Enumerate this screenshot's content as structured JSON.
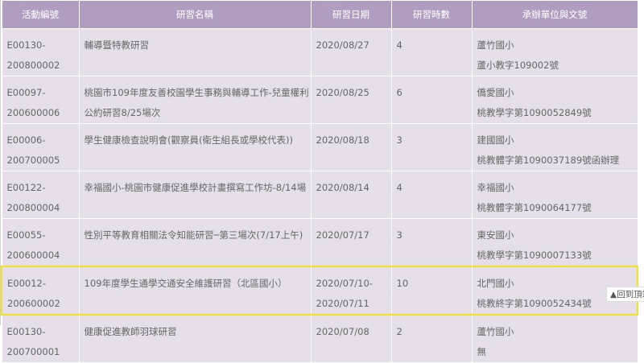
{
  "headers": [
    "活動編號",
    "研習名稱",
    "研習日期",
    "研習時數",
    "承辦單位與文號"
  ],
  "rows": [
    {
      "id": [
        "E00130-",
        "200800002"
      ],
      "name": [
        "輔導暨特教研習"
      ],
      "date": [
        "2020/08/27"
      ],
      "hours": "4",
      "unit": [
        "蘆竹國小",
        "蘆小教字109002號"
      ]
    },
    {
      "id": [
        "E00097-",
        "200600006"
      ],
      "name": [
        "桃園市109年度友善校園學生事務與輔導工作-兒童權利",
        "公約研習8/25場次"
      ],
      "date": [
        "2020/08/25"
      ],
      "hours": "6",
      "unit": [
        "僑愛國小",
        "桃教學字第1090052849號"
      ]
    },
    {
      "id": [
        "E00006-",
        "200700005"
      ],
      "name": [
        "學生健康檢查說明會(觀察員(衛生組長或學校代表))"
      ],
      "date": [
        "2020/08/18"
      ],
      "hours": "3",
      "unit": [
        "建國國小",
        "桃教體字第1090037189號函辦理"
      ]
    },
    {
      "id": [
        "E00122-",
        "200800004"
      ],
      "name": [
        "幸福國小-桃園市健康促進學校計畫撰寫工作坊-8/14場"
      ],
      "date": [
        "2020/08/14"
      ],
      "hours": "4",
      "unit": [
        "幸福國小",
        "桃教體字第1090064177號"
      ]
    },
    {
      "id": [
        "E00055-",
        "200600004"
      ],
      "name": [
        "性別平等教育相關法令知能研習─第三場次(7/17上午)"
      ],
      "date": [
        "2020/07/17"
      ],
      "hours": "3",
      "unit": [
        "東安國小",
        "桃教學字第1090007133號"
      ]
    },
    {
      "id": [
        "E00012-",
        "200600002"
      ],
      "name": [
        "109年度學生通學交通安全維護研習（北區國小）"
      ],
      "date": [
        "2020/07/10-",
        "2020/07/11"
      ],
      "hours": "10",
      "unit": [
        "北門國小",
        "桃教終字第1090052434號"
      ],
      "highlighted": true
    },
    {
      "id": [
        "E00130-",
        "200700001"
      ],
      "name": [
        "健康促進教師羽球研習"
      ],
      "date": [
        "2020/07/08"
      ],
      "hours": "2",
      "unit": [
        "蘆竹國小",
        "無"
      ]
    }
  ],
  "back_to_top_label": "▲回到頂端"
}
